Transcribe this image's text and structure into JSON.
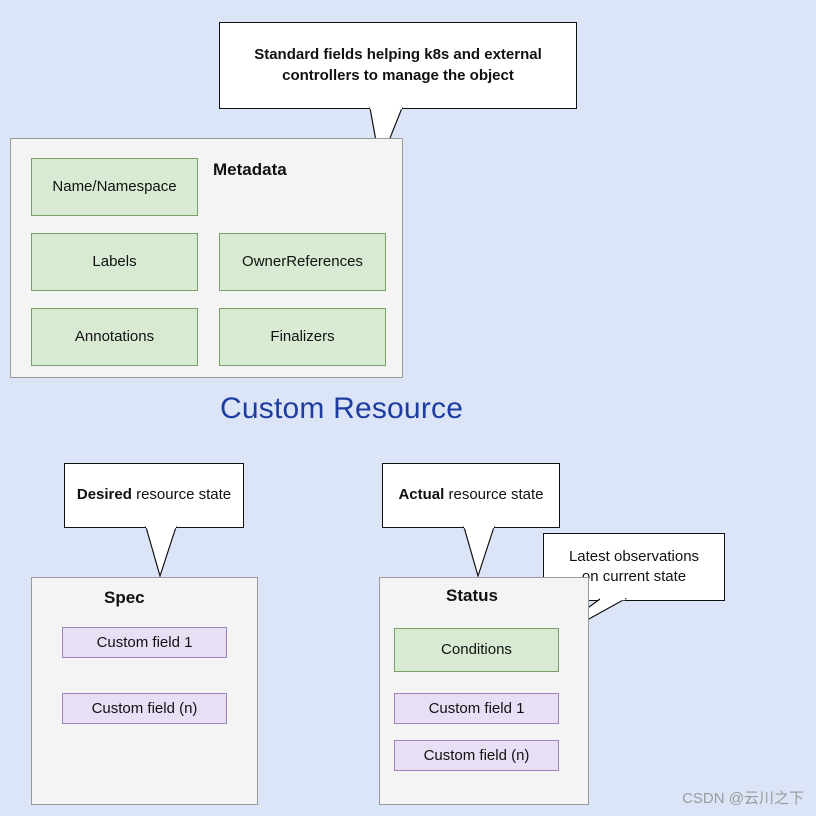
{
  "diagram": {
    "title": "Custom Resource",
    "background_color": "#dbe5f7",
    "title_color": "#1f3da1"
  },
  "callouts": {
    "metadata_note": {
      "bold_prefix": "Standard fields helping k8s and external",
      "rest": "controllers to manage the object"
    },
    "spec_note": {
      "bold_prefix": "Desired",
      "rest": " resource state"
    },
    "status_note": {
      "bold_prefix": "Actual",
      "rest": " resource state"
    },
    "conditions_note": {
      "line1": "Latest observations",
      "line2": "on current state"
    }
  },
  "metadata_panel": {
    "title": "Metadata",
    "fields": [
      {
        "label": "Name/Namespace"
      },
      {
        "label": "Labels"
      },
      {
        "label": "OwnerReferences"
      },
      {
        "label": "Annotations"
      },
      {
        "label": "Finalizers"
      }
    ]
  },
  "spec_panel": {
    "title": "Spec",
    "fields": [
      {
        "label": "Custom field 1"
      },
      {
        "label": "Custom field (n)"
      }
    ]
  },
  "status_panel": {
    "title": "Status",
    "fields": [
      {
        "label": "Conditions"
      },
      {
        "label": "Custom field 1"
      },
      {
        "label": "Custom field (n)"
      }
    ]
  },
  "watermark": {
    "text": "CSDN @云川之下"
  }
}
